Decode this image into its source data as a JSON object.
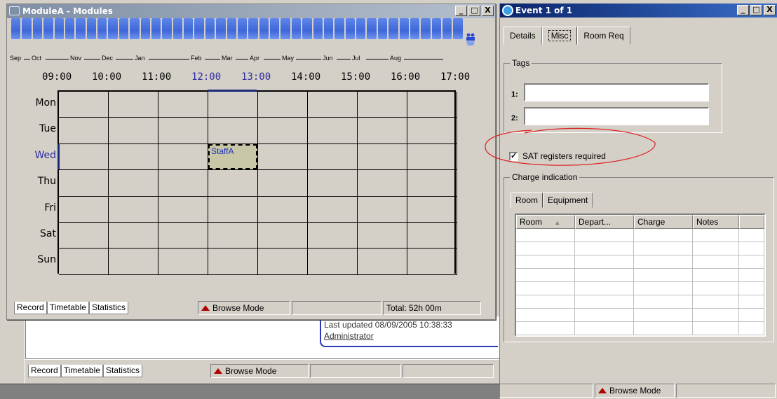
{
  "module_window": {
    "title": "ModuleA - Modules",
    "buttons": [
      "_",
      "□",
      "X"
    ],
    "months": [
      "Sep",
      "Oct",
      "Nov",
      "Dec",
      "Jan",
      "Feb",
      "Mar",
      "Apr",
      "May",
      "Jun",
      "Jul",
      "Aug"
    ],
    "week_count": 42,
    "hours": [
      "09:00",
      "10:00",
      "11:00",
      "12:00",
      "13:00",
      "14:00",
      "15:00",
      "16:00",
      "17:00"
    ],
    "days": [
      "Mon",
      "Tue",
      "Wed",
      "Thu",
      "Fri",
      "Sat",
      "Sun"
    ],
    "event_label": "StaffA",
    "tabs": [
      "Record",
      "Timetable",
      "Statistics"
    ],
    "mode": "Browse Mode",
    "total": "Total:  52h 00m",
    "highlight_color": "#2a2aa0",
    "icons": {
      "users": "users-icon",
      "title": "book-icon"
    }
  },
  "background_window": {
    "last_updated": "Last updated 08/09/2005 10:38:33",
    "user": "Administrator",
    "tabs": [
      "Record",
      "Timetable",
      "Statistics"
    ],
    "mode": "Browse Mode"
  },
  "event_window": {
    "title": "Event 1 of 1",
    "buttons": [
      "_",
      "□",
      "X"
    ],
    "tabs": [
      "Details",
      "Misc",
      "Room Req"
    ],
    "active_tab": "Misc",
    "tags_title": "Tags",
    "tag1_label": "1:",
    "tag2_label": "2:",
    "tag1_value": "",
    "tag2_value": "",
    "sat_label": "SAT registers required",
    "sat_checked": true,
    "charge_title": "Charge indication",
    "charge_tabs": [
      "Room",
      "Equipment"
    ],
    "columns": [
      "Room",
      "Depart...",
      "Charge",
      "Notes"
    ],
    "mode": "Browse Mode",
    "annotation_color": "#dd2222"
  }
}
